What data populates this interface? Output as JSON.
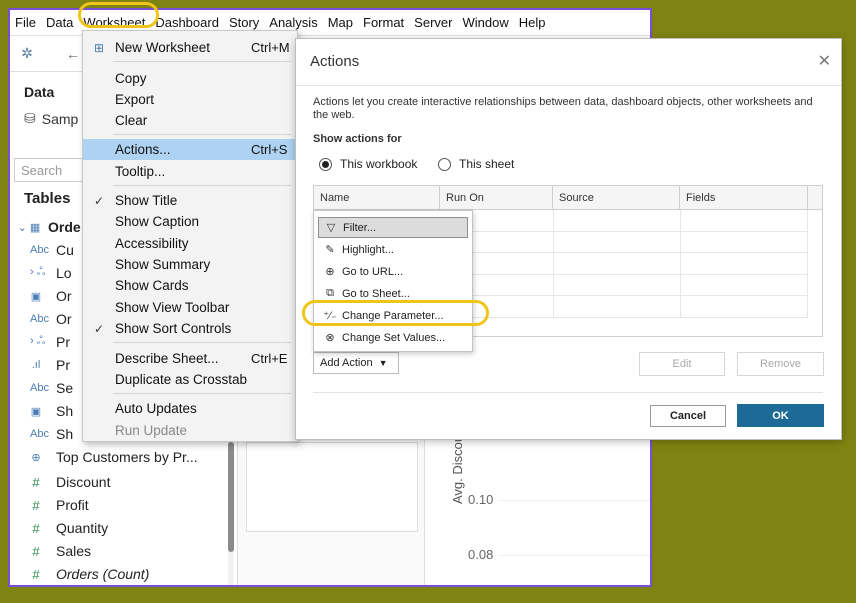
{
  "menubar": [
    "File",
    "Data",
    "Worksheet",
    "Dashboard",
    "Story",
    "Analysis",
    "Map",
    "Format",
    "Server",
    "Window",
    "Help"
  ],
  "left_pane": {
    "header": "Data",
    "source": "Samp",
    "search_placeholder": "Search",
    "tables_heading": "Tables",
    "fields": [
      {
        "icon": "table-icon",
        "type": "table",
        "label": "Orde"
      },
      {
        "icon": "abc-icon",
        "type": "dim",
        "label": "Cu"
      },
      {
        "icon": "hierarchy-icon",
        "type": "dim",
        "label": "Lo"
      },
      {
        "icon": "date-icon",
        "type": "dim",
        "label": "Or"
      },
      {
        "icon": "abc-icon",
        "type": "dim",
        "label": "Or"
      },
      {
        "icon": "hierarchy-icon",
        "type": "dim",
        "label": "Pr"
      },
      {
        "icon": "bars-icon",
        "type": "dim",
        "label": "Pr"
      },
      {
        "icon": "abc-icon",
        "type": "dim",
        "label": "Se"
      },
      {
        "icon": "date-icon",
        "type": "dim",
        "label": "Sh"
      },
      {
        "icon": "abc-icon",
        "type": "dim",
        "label": "Sh"
      },
      {
        "icon": "set-icon",
        "type": "dim",
        "label": "Top Customers by Pr..."
      },
      {
        "icon": "hash-icon",
        "type": "measure",
        "label": "Discount"
      },
      {
        "icon": "hash-icon",
        "type": "measure",
        "label": "Profit"
      },
      {
        "icon": "hash-icon",
        "type": "measure",
        "label": "Quantity"
      },
      {
        "icon": "hash-icon",
        "type": "measure",
        "label": "Sales"
      },
      {
        "icon": "hash-icon",
        "type": "measure",
        "label": "Orders (Count)"
      }
    ]
  },
  "worksheet_menu": {
    "items": [
      {
        "label": "New Worksheet",
        "shortcut": "Ctrl+M",
        "checked": false
      },
      {
        "label": "Copy",
        "shortcut": "",
        "checked": false
      },
      {
        "label": "Export",
        "shortcut": "",
        "checked": false
      },
      {
        "label": "Clear",
        "shortcut": "",
        "checked": false
      },
      {
        "label": "Actions...",
        "shortcut": "Ctrl+S",
        "checked": false,
        "selected": true
      },
      {
        "label": "Tooltip...",
        "shortcut": "",
        "checked": false
      },
      {
        "label": "Show Title",
        "shortcut": "",
        "checked": true
      },
      {
        "label": "Show Caption",
        "shortcut": "",
        "checked": false
      },
      {
        "label": "Accessibility",
        "shortcut": "",
        "checked": false
      },
      {
        "label": "Show Summary",
        "shortcut": "",
        "checked": false
      },
      {
        "label": "Show Cards",
        "shortcut": "",
        "checked": false
      },
      {
        "label": "Show View Toolbar",
        "shortcut": "",
        "checked": false
      },
      {
        "label": "Show Sort Controls",
        "shortcut": "",
        "checked": true
      },
      {
        "label": "Describe Sheet...",
        "shortcut": "Ctrl+E",
        "checked": false
      },
      {
        "label": "Duplicate as Crosstab",
        "shortcut": "",
        "checked": false
      },
      {
        "label": "Auto Updates",
        "shortcut": "",
        "checked": false
      },
      {
        "label": "Run Update",
        "shortcut": "",
        "checked": false,
        "disabled": true
      }
    ]
  },
  "chart_area": {
    "axis_title": "Avg. Discoun",
    "ticks": [
      "0.10",
      "0.08"
    ]
  },
  "dialog": {
    "title": "Actions",
    "description": "Actions let you create interactive relationships between data, dashboard objects, other worksheets and the web.",
    "show_actions_for": "Show actions for",
    "radio_workbook": "This workbook",
    "radio_sheet": "This sheet",
    "columns": [
      "Name",
      "Run On",
      "Source",
      "Fields"
    ],
    "add_action": "Add Action",
    "edit": "Edit",
    "remove": "Remove",
    "cancel": "Cancel",
    "ok": "OK"
  },
  "add_action_menu": [
    {
      "icon": "filter-icon",
      "label": "Filter...",
      "highlighted": true
    },
    {
      "icon": "highlight-icon",
      "label": "Highlight..."
    },
    {
      "icon": "globe-icon",
      "label": "Go to URL..."
    },
    {
      "icon": "sheet-link-icon",
      "label": "Go to Sheet..."
    },
    {
      "icon": "parameter-icon",
      "label": "Change Parameter..."
    },
    {
      "icon": "set-icon",
      "label": "Change Set Values..."
    }
  ],
  "colors": {
    "accent": "#1d6a96",
    "selection": "#aed3f2",
    "annotation": "#f0c419",
    "frame": "#7c4dd6",
    "background": "#7e8412"
  }
}
